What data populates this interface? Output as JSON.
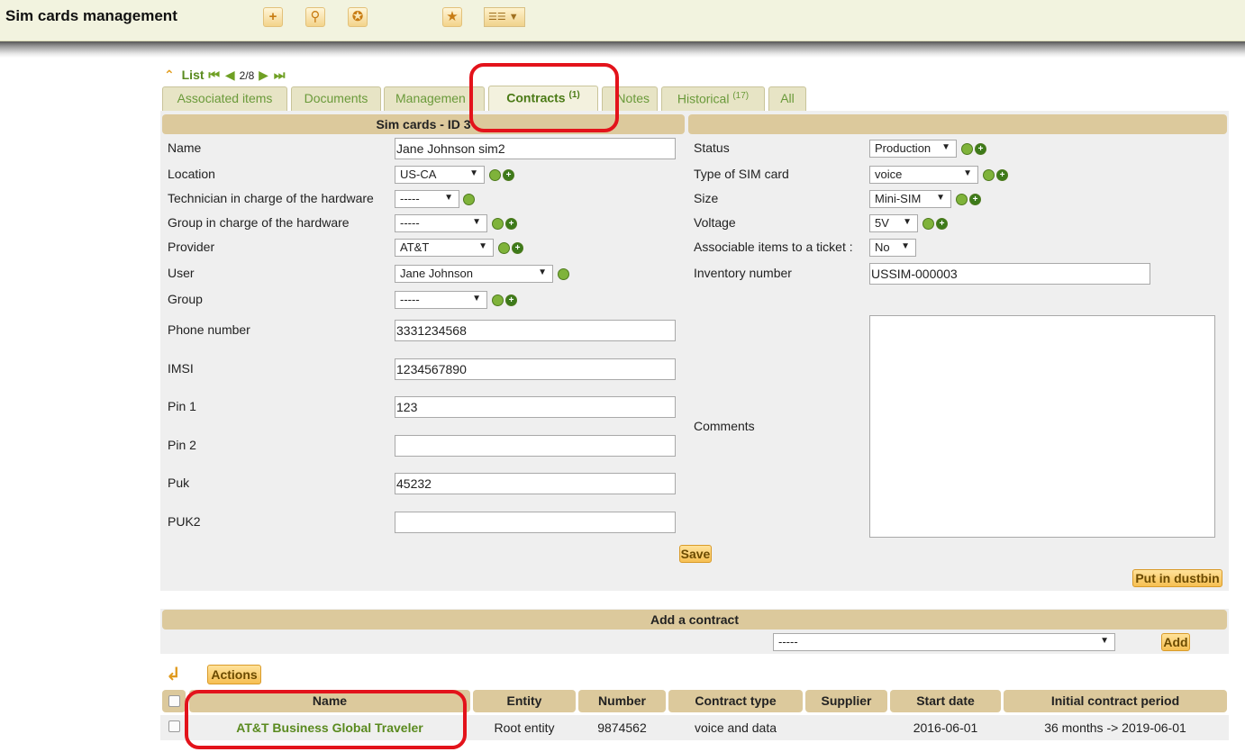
{
  "app": {
    "title": "Sim cards management"
  },
  "nav": {
    "list_label": "List",
    "position": "2/8"
  },
  "tabs": [
    {
      "label": "Associated items",
      "count": ""
    },
    {
      "label": "Documents",
      "count": ""
    },
    {
      "label": "Managemen",
      "count": ""
    },
    {
      "label": "Contracts",
      "count": "(1)"
    },
    {
      "label": "Notes",
      "count": ""
    },
    {
      "label": "Historical",
      "count": "(17)"
    },
    {
      "label": "All",
      "count": ""
    }
  ],
  "form": {
    "header_left": "Sim cards - ID 3",
    "fields_left": {
      "name": {
        "label": "Name",
        "value": "Jane Johnson sim2"
      },
      "location": {
        "label": "Location",
        "value": "US-CA"
      },
      "technician": {
        "label": "Technician in charge of the hardware",
        "value": "-----"
      },
      "group_hw": {
        "label": "Group in charge of the hardware",
        "value": "-----"
      },
      "provider": {
        "label": "Provider",
        "value": "AT&T"
      },
      "user": {
        "label": "User",
        "value": "Jane Johnson"
      },
      "group": {
        "label": "Group",
        "value": "-----"
      },
      "phone": {
        "label": "Phone number",
        "value": "3331234568"
      },
      "imsi": {
        "label": "IMSI",
        "value": "1234567890"
      },
      "pin1": {
        "label": "Pin 1",
        "value": "123"
      },
      "pin2": {
        "label": "Pin 2",
        "value": ""
      },
      "puk": {
        "label": "Puk",
        "value": "45232"
      },
      "puk2": {
        "label": "PUK2",
        "value": ""
      }
    },
    "fields_right": {
      "status": {
        "label": "Status",
        "value": "Production"
      },
      "sim_type": {
        "label": "Type of SIM card",
        "value": "voice"
      },
      "size": {
        "label": "Size",
        "value": "Mini-SIM"
      },
      "voltage": {
        "label": "Voltage",
        "value": "5V"
      },
      "associable": {
        "label": "Associable items to a ticket :",
        "value": "No"
      },
      "inventory": {
        "label": "Inventory number",
        "value": "USSIM-000003"
      },
      "comments": {
        "label": "Comments",
        "value": ""
      }
    },
    "save_label": "Save",
    "dustbin_label": "Put in dustbin"
  },
  "add_contract": {
    "header": "Add a contract",
    "select_value": "-----",
    "add_label": "Add"
  },
  "actions_label": "Actions",
  "contracts_table": {
    "headers": [
      "Name",
      "Entity",
      "Number",
      "Contract type",
      "Supplier",
      "Start date",
      "Initial contract period"
    ],
    "rows": [
      {
        "name": "AT&T Business Global Traveler",
        "entity": "Root entity",
        "number": "9874562",
        "contract_type": "voice and data",
        "supplier": "",
        "start_date": "2016-06-01",
        "period": "36 months -> 2019-06-01"
      }
    ]
  },
  "colors": {
    "accent": "#dcc99c",
    "link": "#5a8a1f",
    "highlight": "#e3131b",
    "button": "#f6bf52"
  }
}
